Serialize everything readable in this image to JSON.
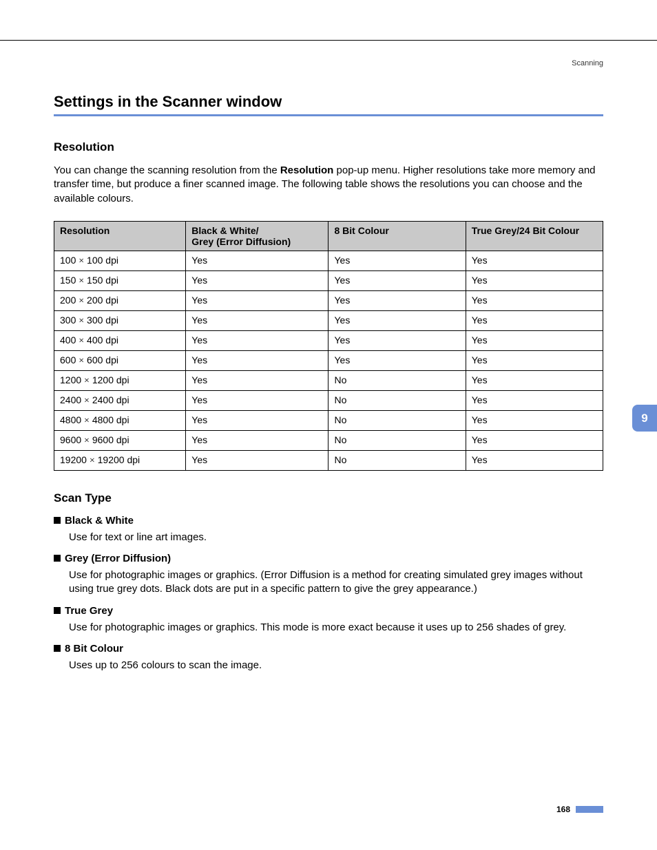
{
  "header": {
    "section": "Scanning"
  },
  "headings": {
    "main": "Settings in the Scanner window",
    "resolution": "Resolution",
    "scan_type": "Scan Type"
  },
  "paragraphs": {
    "resolution_pre": "You can change the scanning resolution from the ",
    "resolution_bold": "Resolution",
    "resolution_post": " pop-up menu. Higher resolutions take more memory and transfer time, but produce a finer scanned image. The following table shows the resolutions you can choose and the available colours."
  },
  "table": {
    "headers": {
      "resolution": "Resolution",
      "bw_line1": "Black & White/",
      "bw_line2": "Grey (Error Diffusion)",
      "eightbit": "8 Bit Colour",
      "truegrey": "True Grey/24 Bit Colour"
    },
    "rows": [
      {
        "res_a": "100",
        "res_b": "100 dpi",
        "bw": "Yes",
        "eb": "Yes",
        "tg": "Yes"
      },
      {
        "res_a": "150",
        "res_b": "150 dpi",
        "bw": "Yes",
        "eb": "Yes",
        "tg": "Yes"
      },
      {
        "res_a": "200",
        "res_b": "200 dpi",
        "bw": "Yes",
        "eb": "Yes",
        "tg": "Yes"
      },
      {
        "res_a": "300",
        "res_b": "300 dpi",
        "bw": "Yes",
        "eb": "Yes",
        "tg": "Yes"
      },
      {
        "res_a": "400",
        "res_b": "400 dpi",
        "bw": "Yes",
        "eb": "Yes",
        "tg": "Yes"
      },
      {
        "res_a": "600",
        "res_b": "600 dpi",
        "bw": "Yes",
        "eb": "Yes",
        "tg": "Yes"
      },
      {
        "res_a": "1200",
        "res_b": "1200 dpi",
        "bw": "Yes",
        "eb": "No",
        "tg": "Yes"
      },
      {
        "res_a": "2400",
        "res_b": "2400 dpi",
        "bw": "Yes",
        "eb": "No",
        "tg": "Yes"
      },
      {
        "res_a": "4800",
        "res_b": "4800 dpi",
        "bw": "Yes",
        "eb": "No",
        "tg": "Yes"
      },
      {
        "res_a": "9600",
        "res_b": "9600 dpi",
        "bw": "Yes",
        "eb": "No",
        "tg": "Yes"
      },
      {
        "res_a": "19200",
        "res_b": "19200 dpi",
        "bw": "Yes",
        "eb": "No",
        "tg": "Yes"
      }
    ]
  },
  "scan_types": {
    "bw_title": "Black & White",
    "bw_desc": "Use for text or line art images.",
    "grey_title": "Grey (Error Diffusion)",
    "grey_desc": "Use for photographic images or graphics. (Error Diffusion is a method for creating simulated grey images without using true grey dots. Black dots are put in a specific pattern to give the grey appearance.)",
    "true_title": "True Grey",
    "true_desc": "Use for photographic images or graphics. This mode is more exact because it uses up to 256 shades of grey.",
    "eight_title": "8 Bit Colour",
    "eight_desc": "Uses up to 256 colours to scan the image."
  },
  "side_tab": "9",
  "page_number": "168"
}
